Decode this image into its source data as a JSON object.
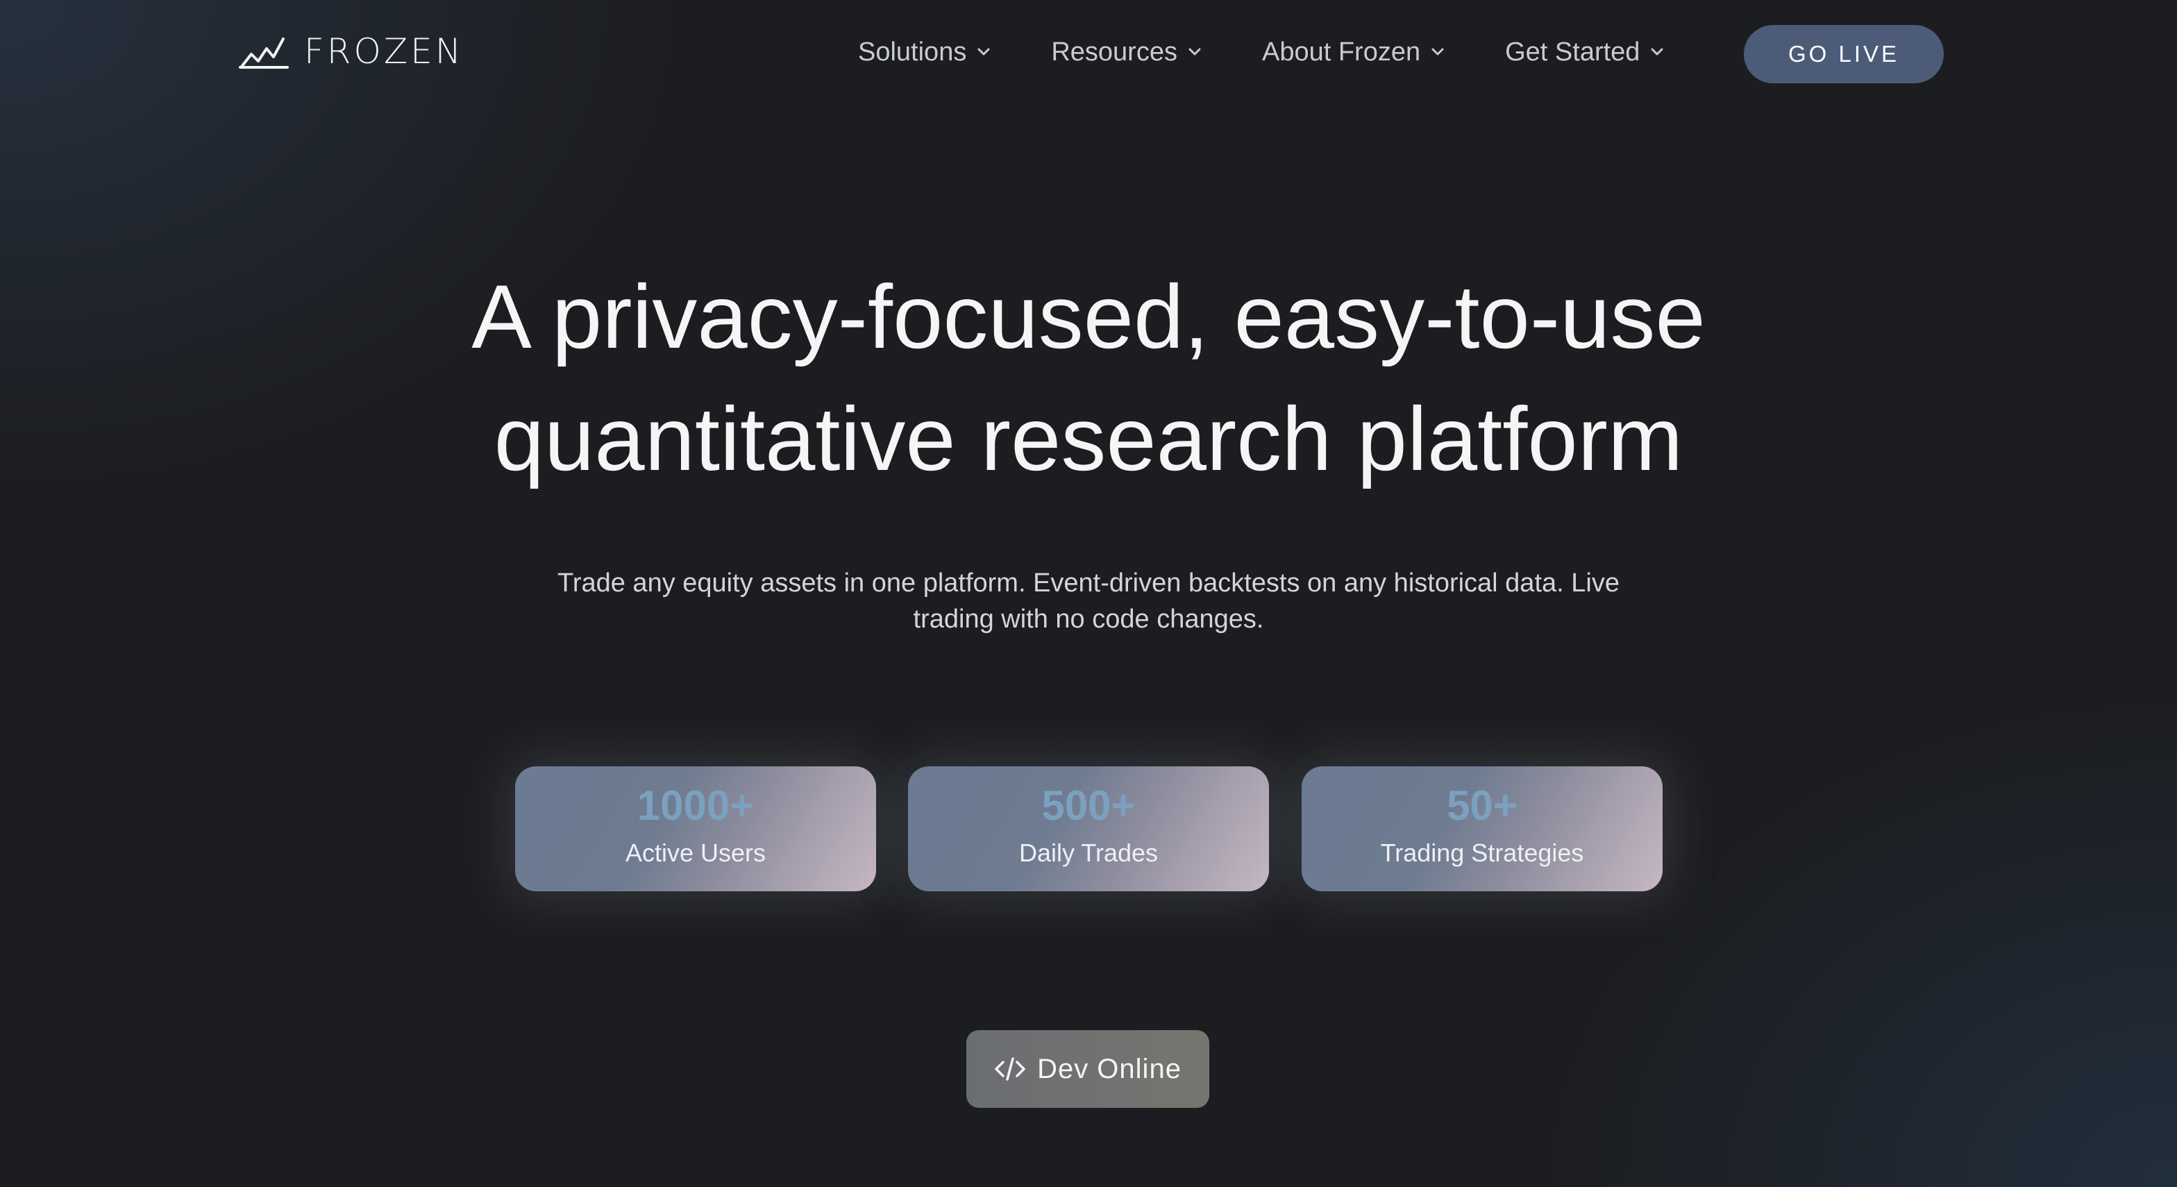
{
  "header": {
    "logo_text": "FROZEN",
    "logo_icon": "chart-trend-icon",
    "nav": [
      {
        "label": "Solutions",
        "icon": "chevron-down-icon"
      },
      {
        "label": "Resources",
        "icon": "chevron-down-icon"
      },
      {
        "label": "About Frozen",
        "icon": "chevron-down-icon"
      },
      {
        "label": "Get Started",
        "icon": "chevron-down-icon"
      }
    ],
    "cta_label": "GO LIVE"
  },
  "hero": {
    "title_line1": "A privacy-focused, easy-to-use",
    "title_line2": "quantitative research platform",
    "subtitle_line1": "Trade any equity assets in one platform. Event-driven backtests on any historical data. Live",
    "subtitle_line2": "trading with no code changes."
  },
  "stats": [
    {
      "value": "1000+",
      "label": "Active Users"
    },
    {
      "value": "500+",
      "label": "Daily Trades"
    },
    {
      "value": "50+",
      "label": "Trading Strategies"
    }
  ],
  "dev_button": {
    "label": "Dev Online",
    "icon": "code-icon"
  },
  "colors": {
    "background": "#1c1d20",
    "cta_background": "#4c5b78",
    "stat_value": "#7ca1bf",
    "stat_gradient_start": "#6b7b92",
    "stat_gradient_end": "#c7b8c4",
    "dev_button_background": "#6f716f"
  }
}
